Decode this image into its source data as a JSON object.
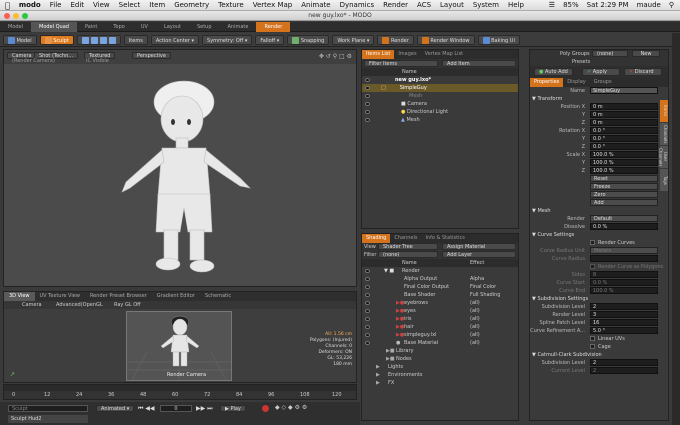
{
  "macmenu": {
    "apple": "",
    "app": "modo",
    "items": [
      "File",
      "Edit",
      "View",
      "Select",
      "Item",
      "Geometry",
      "Texture",
      "Vertex Map",
      "Animate",
      "Dynamics",
      "Render",
      "ACS",
      "Layout",
      "System",
      "Help"
    ],
    "battery": "85%",
    "clock": "Sat 2:29 PM",
    "user": "maude"
  },
  "window": {
    "title": "new guy.lxo* - MODO"
  },
  "layout_tabs": [
    "Model",
    "Model Quad",
    "Paint",
    "Topo",
    "UV",
    "Layout",
    "Setup",
    "Animate",
    "Render"
  ],
  "toolbar": {
    "model": "Model",
    "sculpt": "Sculpt",
    "items": "Items",
    "action_center": "Action Center",
    "symmetry": "Symmetry: Off",
    "falloff": "Falloff",
    "snapping": "Snapping",
    "work_plane": "Work Plane",
    "render": "Render",
    "render_window": "Render Window",
    "baking_ui": "Baking UI"
  },
  "viewport": {
    "menu": [
      "Camera",
      "Shot (Techn...",
      "Textured",
      "Perspective"
    ],
    "sub": [
      "(Render Camera)",
      "IC Visible"
    ],
    "tab_label": "Perspective"
  },
  "lower_viewport": {
    "tabs": [
      "3D View",
      "UV Texture View",
      "Render Preset Browser",
      "Gradient Editor",
      "Schematic"
    ],
    "menu": [
      "Camera",
      "Advanced(OpenGL",
      "Ray GL Off"
    ],
    "stats": [
      "All: 1.56 cm",
      "Polygons: (Injured)",
      "Channels: 0",
      "Deformers: ON",
      "GL: 53,226",
      "180 mm"
    ],
    "camera_label": "Render Camera"
  },
  "timeline": {
    "ticks": [
      "0",
      "12",
      "24",
      "36",
      "48",
      "60",
      "72",
      "84",
      "96",
      "108",
      "120"
    ]
  },
  "playback": {
    "search_placeholder": "Sculpt",
    "animated": "Animated",
    "play": "Play",
    "frame": "0",
    "layer_item": "Sculpt Hud2"
  },
  "itemlist": {
    "tabs": [
      "Items List",
      "Images",
      "Vertex Map List"
    ],
    "filter": "Filter Items",
    "add": "Add Item",
    "header": "Name",
    "rows": [
      "new guy.lxo*",
      "SimpleGuy",
      "Mesh",
      "Camera",
      "Directional Light",
      "Mesh"
    ]
  },
  "shading": {
    "tabs": [
      "Shading",
      "Channels",
      "Info & Statistics"
    ],
    "view": "View",
    "view_value": "Shader Tree",
    "assign": "Assign Material",
    "filter": "Filter",
    "filter_value": "(none)",
    "add_layer": "Add Layer",
    "cols": [
      "Name",
      "Effect"
    ],
    "rows": [
      {
        "n": "Render",
        "e": ""
      },
      {
        "n": "Alpha Output",
        "e": "Alpha"
      },
      {
        "n": "Final Color Output",
        "e": "Final Color"
      },
      {
        "n": "Base Shader",
        "e": "Full Shading"
      },
      {
        "n": "eyebrows",
        "e": "(all)"
      },
      {
        "n": "eyes",
        "e": "(all)"
      },
      {
        "n": "iris",
        "e": "(all)"
      },
      {
        "n": "hair",
        "e": "(all)"
      },
      {
        "n": "simpleguy.lxl",
        "e": "(all)"
      },
      {
        "n": "Base Material",
        "e": "(all)"
      },
      {
        "n": "Library",
        "e": ""
      },
      {
        "n": "Nodes",
        "e": ""
      },
      {
        "n": "Lights",
        "e": ""
      },
      {
        "n": "Environments",
        "e": ""
      },
      {
        "n": "FX",
        "e": ""
      }
    ]
  },
  "props": {
    "poly_groups": "Poly Groups",
    "poly_groups_val": "(none)",
    "new": "New",
    "presets": "Presets",
    "auto_add": "Auto Add",
    "apply": "Apply",
    "discard": "Discard",
    "tabs": [
      "Properties",
      "Display",
      "Groups"
    ],
    "name_label": "Name",
    "name": "SimpleGuy",
    "transform": "Transform",
    "position_label": "Position X",
    "position": [
      "0 m",
      "0 m",
      "0 m"
    ],
    "rotation_label": "Rotation X",
    "rotation": [
      "0.0 °",
      "0.0 °",
      "0.0 °"
    ],
    "scale_label": "Scale X",
    "scale": [
      "100.0 %",
      "100.0 %",
      "100.0 %"
    ],
    "yz": [
      "Y",
      "Z"
    ],
    "xform_btns": [
      "Reset",
      "Freeze",
      "Zero",
      "Add"
    ],
    "mesh": "Mesh",
    "render_label": "Render",
    "render_val": "Default",
    "dissolve_label": "Dissolve",
    "dissolve_val": "0.0 %",
    "curve_settings": "Curve Settings",
    "render_curves": "Render Curves",
    "curve_radius": "Curve Radius Unit",
    "curve_radius_val": "Meters",
    "curve_radius2": "Curve Radius",
    "render_poly": "Render Curve as Polygons",
    "sides": "Sides",
    "sides_val": "8",
    "curve_start": "Curve Start",
    "curve_start_val": "0.0 %",
    "curve_end": "Curve End",
    "curve_end_val": "100.0 %",
    "subdiv": "Subdivision Settings",
    "subdiv_level": "Subdivision Level",
    "subdiv_level_val": "2",
    "render_level": "Render Level",
    "render_level_val": "3",
    "spline_patch": "Spline Patch Level",
    "spline_patch_val": "16",
    "curve_ref": "Curve Refinement A...",
    "curve_ref_val": "5.0 °",
    "linear_uvs": "Linear UVs",
    "cage": "Cage",
    "catmull": "Catmull-Clark Subdivision",
    "cc_subdiv": "Subdivision Level",
    "cc_subdiv_val": "2",
    "cc_current": "Current Level",
    "cc_current_val": "2",
    "side_tabs": [
      "Items",
      "Channels",
      "User Channels",
      "Tags"
    ]
  },
  "colors": {
    "accent": "#d4731c",
    "select": "#6a5a2a",
    "field": "#1e1e1e"
  }
}
